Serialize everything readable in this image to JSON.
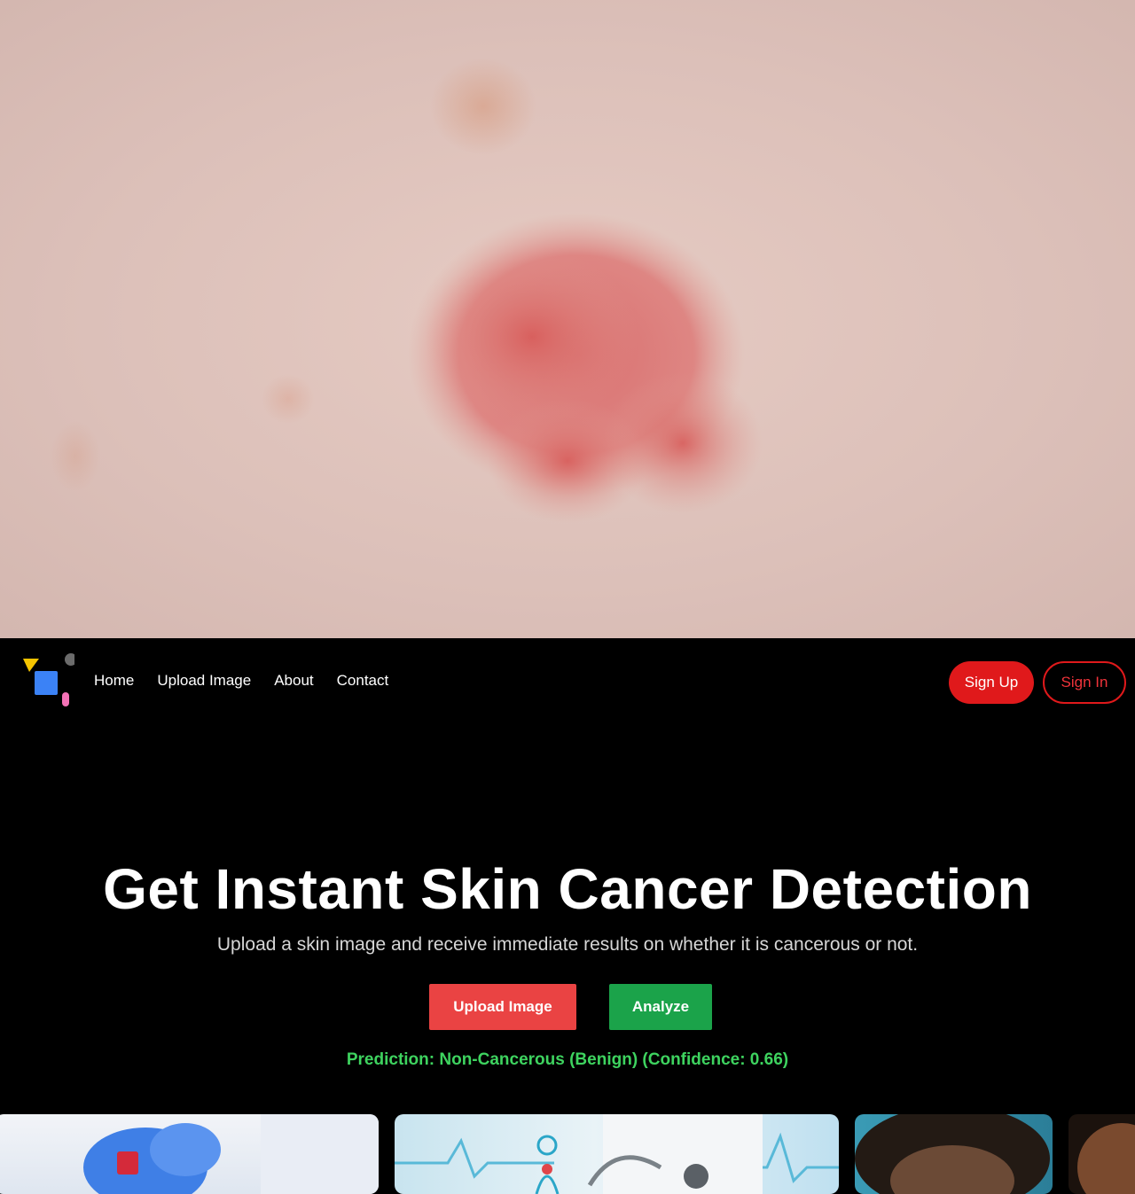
{
  "nav": {
    "links": [
      {
        "label": "Home"
      },
      {
        "label": "Upload Image"
      },
      {
        "label": "About"
      },
      {
        "label": "Contact"
      }
    ],
    "sign_up_label": "Sign Up",
    "sign_in_label": "Sign In"
  },
  "hero": {
    "title": "Get Instant Skin Cancer Detection",
    "subtitle": "Upload a skin image and receive immediate results on whether it is cancerous or not.",
    "upload_label": "Upload Image",
    "analyze_label": "Analyze",
    "prediction": "Prediction: Non-Cancerous (Benign) (Confidence: 0.66)"
  },
  "colors": {
    "background": "#000000",
    "accent_red": "#e0191b",
    "upload_button": "#ea4343",
    "analyze_button": "#1ba34a",
    "prediction_text": "#3ed35f"
  },
  "icons": {
    "logo": "shapes-logo-icon"
  }
}
